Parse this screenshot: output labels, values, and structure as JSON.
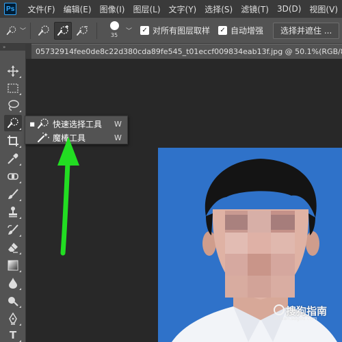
{
  "app": {
    "logo_text": "Ps",
    "accent": "#31a8ff"
  },
  "menu": [
    {
      "label": "文件(F)"
    },
    {
      "label": "编辑(E)"
    },
    {
      "label": "图像(I)"
    },
    {
      "label": "图层(L)"
    },
    {
      "label": "文字(Y)"
    },
    {
      "label": "选择(S)"
    },
    {
      "label": "滤镜(T)"
    },
    {
      "label": "3D(D)"
    },
    {
      "label": "视图(V)"
    }
  ],
  "options": {
    "brush_size": "35",
    "sample_all_layers_label": "对所有图层取样",
    "sample_all_layers_checked": true,
    "auto_enhance_label": "自动增强",
    "auto_enhance_checked": true,
    "select_and_mask_label": "选择并遮住 ..."
  },
  "document": {
    "tab_title": "05732914fee0de8c22d380cda89fe545_t01eccf009834eab13f.jpg @ 50.1%(RGB/8#) *"
  },
  "tools_header": "»",
  "flyout": {
    "items": [
      {
        "label": "快速选择工具",
        "shortcut": "W",
        "selected": true,
        "icon": "quick-selection-icon"
      },
      {
        "label": "魔棒工具",
        "shortcut": "W",
        "selected": false,
        "icon": "magic-wand-icon"
      }
    ],
    "selected_marker": "■"
  },
  "toolbar_tools": [
    {
      "name": "move-tool",
      "icon": "move-icon"
    },
    {
      "name": "marquee-tool",
      "icon": "marquee-icon"
    },
    {
      "name": "lasso-tool",
      "icon": "lasso-icon"
    },
    {
      "name": "quick-selection-tool",
      "icon": "quick-selection-icon"
    },
    {
      "name": "crop-tool",
      "icon": "crop-icon"
    },
    {
      "name": "eyedropper-tool",
      "icon": "eyedropper-icon"
    },
    {
      "name": "healing-brush-tool",
      "icon": "bandage-icon"
    },
    {
      "name": "brush-tool",
      "icon": "brush-icon"
    },
    {
      "name": "clone-stamp-tool",
      "icon": "stamp-icon"
    },
    {
      "name": "history-brush-tool",
      "icon": "history-brush-icon"
    },
    {
      "name": "eraser-tool",
      "icon": "eraser-icon"
    },
    {
      "name": "gradient-tool",
      "icon": "gradient-icon"
    },
    {
      "name": "blur-tool",
      "icon": "drop-icon"
    },
    {
      "name": "dodge-tool",
      "icon": "dodge-icon"
    },
    {
      "name": "pen-tool",
      "icon": "pen-icon"
    },
    {
      "name": "type-tool",
      "icon": "type-icon",
      "glyph": "T"
    }
  ],
  "watermark": {
    "main": "搜狗指南",
    "sub": "zhinan.sogou.com"
  },
  "colors": {
    "photo_background": "#2f72c9",
    "arrow": "#22dd22"
  }
}
